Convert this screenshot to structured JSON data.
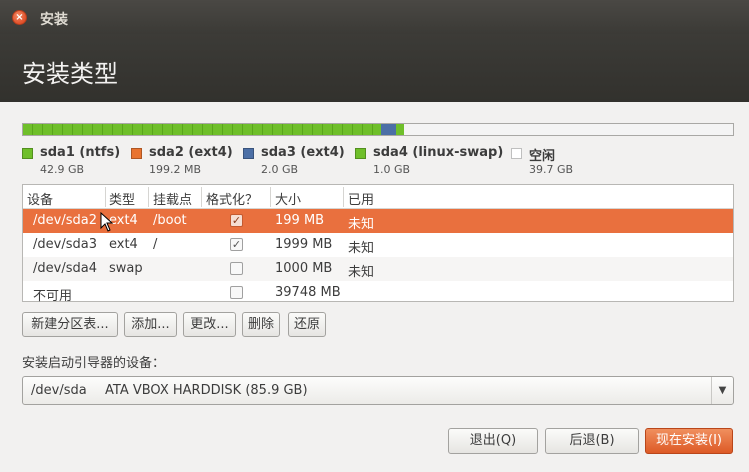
{
  "window": {
    "title": "安装",
    "close_icon": "close-icon"
  },
  "header": {
    "title": "安装类型"
  },
  "partition_bar": {
    "colors": {
      "sda1": "#6fbf2a",
      "sda2": "#e8732f",
      "sda3": "#4c6fa6",
      "sda4": "#6fbf2a",
      "free": "#ffffff"
    }
  },
  "legend": [
    {
      "name": "sda1 (ntfs)",
      "size": "42.9 GB",
      "color": "#6fbf2a"
    },
    {
      "name": "sda2 (ext4)",
      "size": "199.2 MB",
      "color": "#e8732f"
    },
    {
      "name": "sda3 (ext4)",
      "size": "2.0 GB",
      "color": "#4c6fa6"
    },
    {
      "name": "sda4 (linux-swap)",
      "size": "1.0 GB",
      "color": "#6fbf2a"
    },
    {
      "name": "空闲",
      "size": "39.7 GB",
      "color": "#ffffff"
    }
  ],
  "table": {
    "headers": [
      "设备",
      "类型",
      "挂载点",
      "格式化？",
      "大小",
      "已用"
    ],
    "rows": [
      {
        "device": "/dev/sda2",
        "type": "ext4",
        "mount": "/boot",
        "format": true,
        "size": "199 MB",
        "used": "未知",
        "selected": true
      },
      {
        "device": "/dev/sda3",
        "type": "ext4",
        "mount": "/",
        "format": true,
        "size": "1999 MB",
        "used": "未知",
        "selected": false
      },
      {
        "device": "/dev/sda4",
        "type": "swap",
        "mount": "",
        "format": false,
        "size": "1000 MB",
        "used": "未知",
        "selected": false
      },
      {
        "device": "不可用",
        "type": "",
        "mount": "",
        "format": false,
        "size": "39748 MB",
        "used": "",
        "selected": false
      }
    ],
    "check_mark": "✓"
  },
  "actions": {
    "new_table": "新建分区表...",
    "add": "添加...",
    "change": "更改...",
    "delete": "删除",
    "revert": "还原"
  },
  "bootloader": {
    "label": "安装启动引导器的设备：",
    "device": "/dev/sda",
    "description": "ATA VBOX HARDDISK (85.9 GB)",
    "arrow_icon": "chevron-down-icon"
  },
  "footer": {
    "quit": "退出(Q)",
    "back": "后退(B)",
    "install_now": "现在安装(I)"
  }
}
